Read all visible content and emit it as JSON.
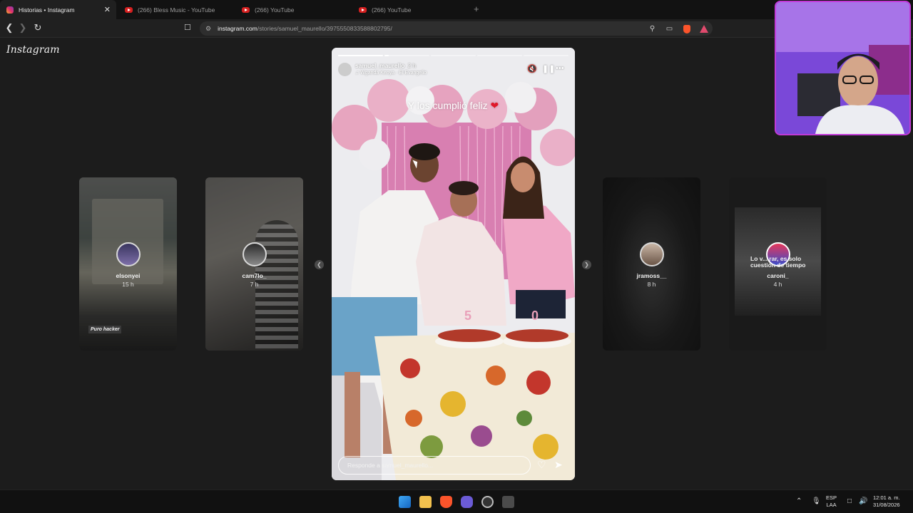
{
  "browser": {
    "tabs": [
      {
        "title": "Historias • Instagram",
        "active": true,
        "icon": "instagram-icon"
      },
      {
        "title": "(266) Bless Music - YouTube",
        "active": false,
        "icon": "youtube-icon"
      },
      {
        "title": "(266) YouTube",
        "active": false,
        "icon": "youtube-icon"
      },
      {
        "title": "(266) YouTube",
        "active": false,
        "icon": "youtube-icon"
      }
    ],
    "close_tab_glyph": "✕",
    "new_tab_glyph": "+",
    "url_host": "instagram.com",
    "url_path": "/stories/samuel_maurello/3975550833588802795/"
  },
  "page": {
    "logo": "Instagram"
  },
  "stories_left": [
    {
      "username": "elsonyei",
      "time": "15 h",
      "sticker": "Puro hacker"
    },
    {
      "username": "cam7lo_",
      "time": "7 h"
    }
  ],
  "stories_right": [
    {
      "username": "jramoss__",
      "time": "8 h"
    },
    {
      "username": "caroni_",
      "time": "4 h",
      "overlay_text": "Lo v... rar, es solo cuestión de tiempo"
    }
  ],
  "main_story": {
    "username": "samuel_maurello",
    "time": "2 h",
    "music": "Wganda Kenya · El Evangelio",
    "caption": "Y los cumplió feliz",
    "caption_emoji": "❤",
    "reply_placeholder": "Responde a samuel_maurello...",
    "progress": [
      1,
      0.1,
      0,
      0,
      0
    ]
  },
  "taskbar": {
    "language": "ESP",
    "layout": "LAA",
    "time": "12:01 a. m.",
    "date": "31/08/2026"
  },
  "colors": {
    "accent_pink": "#e8a9c2",
    "heart_red": "#e0182a"
  }
}
